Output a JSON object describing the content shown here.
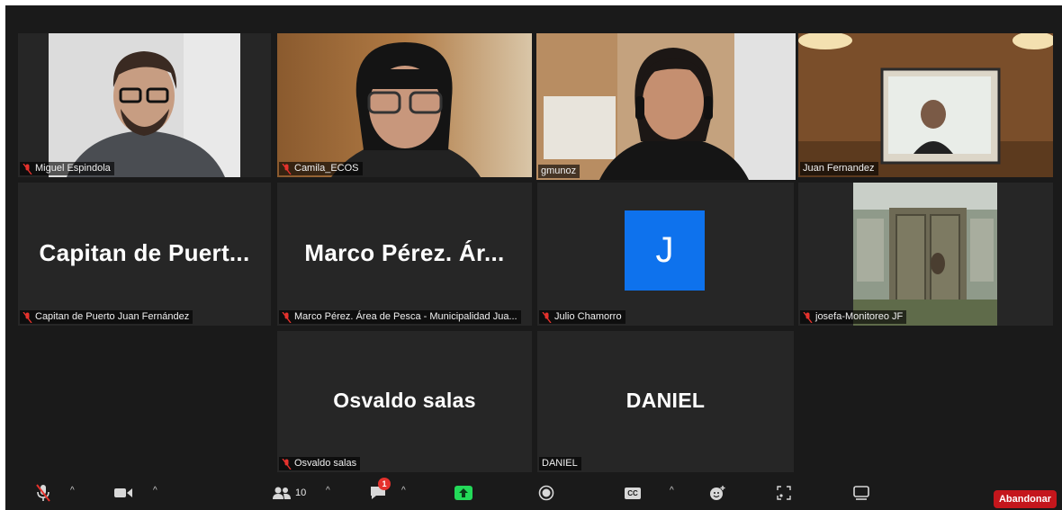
{
  "participants": [
    {
      "name": "Miguel Espindola",
      "muted": true
    },
    {
      "name": "Camila_ECOS",
      "muted": true
    },
    {
      "name": "gmunoz",
      "muted": false,
      "active_speaker": true
    },
    {
      "name": "Juan Fernandez",
      "muted": false
    },
    {
      "name": "Capitan de Puerto Juan Fernández",
      "display": "Capitan de Puert...",
      "muted": true
    },
    {
      "name": "Marco Pérez. Área de Pesca - Municipalidad Jua...",
      "display": "Marco Pérez. Ár...",
      "muted": true
    },
    {
      "name": "Julio Chamorro",
      "avatar_letter": "J",
      "muted": true
    },
    {
      "name": "josefa-Monitoreo JF",
      "muted": true
    },
    {
      "name": "Osvaldo salas",
      "display": "Osvaldo salas",
      "muted": true
    },
    {
      "name": "DANIEL",
      "display": "DANIEL",
      "muted": false
    }
  ],
  "toolbar": {
    "participants_count": "10",
    "chat_badge": "1",
    "cc_label": "CC",
    "leave_label": "Abandonar"
  },
  "colors": {
    "active_speaker_border": "#cde06a",
    "avatar_bg": "#0e72ed",
    "leave_bg": "#c4161c",
    "share_green": "#23d959",
    "mute_red": "#e5322d"
  }
}
